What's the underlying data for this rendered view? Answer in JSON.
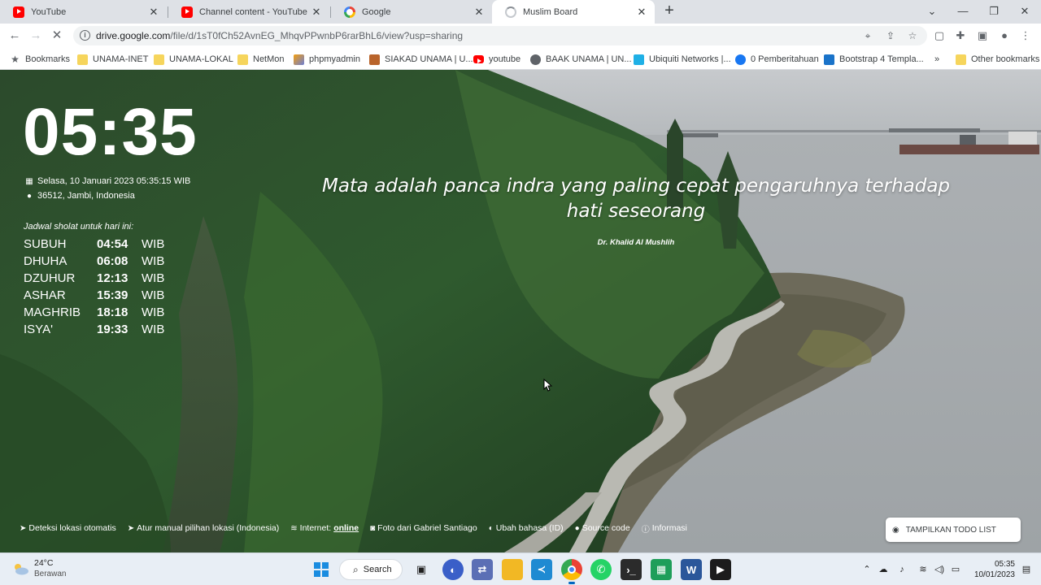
{
  "tabs": [
    {
      "title": "YouTube",
      "favicon": "youtube-icon"
    },
    {
      "title": "Channel content - YouTube Studio",
      "favicon": "youtube-icon"
    },
    {
      "title": "Google",
      "favicon": "google-icon"
    },
    {
      "title": "Muslim Board",
      "favicon": "loading-spinner-icon"
    }
  ],
  "address_bar": {
    "url_host": "drive.google.com",
    "url_path": "/file/d/1sT0fCh52AvnEG_MhqvPPwnbP6rarBhL6/view?usp=sharing"
  },
  "bookmarks": [
    {
      "label": "Bookmarks",
      "icon": "star-icon"
    },
    {
      "label": "UNAMA-INET",
      "icon": "folder-icon"
    },
    {
      "label": "UNAMA-LOKAL",
      "icon": "folder-icon"
    },
    {
      "label": "NetMon",
      "icon": "folder-icon"
    },
    {
      "label": "phpmyadmin",
      "icon": "phpmyadmin-icon"
    },
    {
      "label": "SIAKAD UNAMA | U...",
      "icon": "siakad-icon"
    },
    {
      "label": "youtube",
      "icon": "youtube-icon"
    },
    {
      "label": "BAAK UNAMA | UN...",
      "icon": "globe-icon"
    },
    {
      "label": "Ubiquiti Networks |...",
      "icon": "ubiquiti-icon"
    },
    {
      "label": "0 Pemberitahuan",
      "icon": "facebook-icon"
    },
    {
      "label": "Bootstrap 4 Templa...",
      "icon": "bootstrap-icon"
    },
    {
      "label": "»",
      "icon": "more-icon"
    },
    {
      "label": "Other bookmarks",
      "icon": "folder-icon"
    }
  ],
  "page": {
    "clock": "05:35",
    "datetime": "Selasa, 10 Januari 2023 05:35:15 WIB",
    "location": "36512, Jambi, Indonesia",
    "schedule_title": "Jadwal sholat untuk hari ini:",
    "prayers": [
      {
        "name": "SUBUH",
        "time": "04:54",
        "zone": "WIB"
      },
      {
        "name": "DHUHA",
        "time": "06:08",
        "zone": "WIB"
      },
      {
        "name": "DZUHUR",
        "time": "12:13",
        "zone": "WIB"
      },
      {
        "name": "ASHAR",
        "time": "15:39",
        "zone": "WIB"
      },
      {
        "name": "MAGHRIB",
        "time": "18:18",
        "zone": "WIB"
      },
      {
        "name": "ISYA'",
        "time": "19:33",
        "zone": "WIB"
      }
    ],
    "quote": "Mata adalah panca indra yang paling cepat pengaruhnya terhadap hati seseorang",
    "quote_author": "Dr. Khalid Al Mushlih",
    "footer_links": {
      "auto_location": "Deteksi lokasi otomatis",
      "manual_location": "Atur manual pilihan lokasi (Indonesia)",
      "internet_label": "Internet:",
      "internet_status": "online",
      "photo_credit": "Foto dari Gabriel Santiago",
      "language": "Ubah bahasa (ID)",
      "source_code": "Source code",
      "info": "Informasi"
    },
    "todo_button": "TAMPILKAN TODO LIST"
  },
  "taskbar": {
    "weather_temp": "24°C",
    "weather_cond": "Berawan",
    "search_label": "Search",
    "time": "05:35",
    "date": "10/01/2023"
  },
  "colors": {
    "chrome_tabstrip": "#dee1e6",
    "taskbar": "#e8eef5",
    "forest_dark": "#1f3d22",
    "water": "#a9adb0"
  }
}
